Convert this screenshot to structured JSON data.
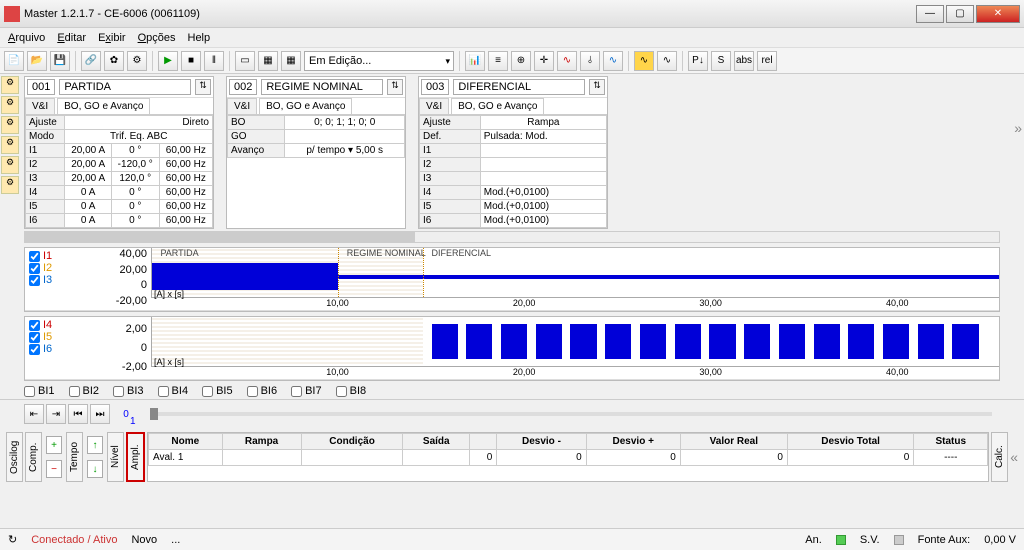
{
  "window": {
    "title": "Master 1.2.1.7 - CE-6006 (0061109)"
  },
  "menu": [
    "Arquivo",
    "Editar",
    "Exibir",
    "Opções",
    "Help"
  ],
  "toolbar_sel": "Em Edição...",
  "panels": [
    {
      "num": "001",
      "name": "PARTIDA",
      "tab_vi": "V&I",
      "tab_bo": "BO, GO e Avanço",
      "ajuste": "Ajuste",
      "dirlab": "Direto",
      "rows": [
        [
          "Modo",
          "Trif. Eq. ABC",
          "",
          ""
        ],
        [
          "I1",
          "20,00 A",
          "0 °",
          "60,00 Hz"
        ],
        [
          "I2",
          "20,00 A",
          "-120,0 °",
          "60,00 Hz"
        ],
        [
          "I3",
          "20,00 A",
          "120,0 °",
          "60,00 Hz"
        ],
        [
          "I4",
          "0 A",
          "0 °",
          "60,00 Hz"
        ],
        [
          "I5",
          "0 A",
          "0 °",
          "60,00 Hz"
        ],
        [
          "I6",
          "0 A",
          "0 °",
          "60,00 Hz"
        ]
      ]
    },
    {
      "num": "002",
      "name": "REGIME NOMINAL",
      "tab_vi": "V&I",
      "tab_bo": "BO, GO e Avanço",
      "rows": [
        [
          "BO",
          "0; 0; 1; 1; 0; 0"
        ],
        [
          "GO",
          ""
        ],
        [
          "Avanço",
          "p/ tempo   ▾   5,00 s"
        ]
      ]
    },
    {
      "num": "003",
      "name": "DIFERENCIAL",
      "tab_vi": "V&I",
      "tab_bo": "BO, GO e Avanço",
      "ajuste": "Ajuste",
      "ramp": "Rampa",
      "def": "Def.",
      "puls": "Pulsada: Mod.",
      "rows": [
        [
          "I1",
          ""
        ],
        [
          "I2",
          ""
        ],
        [
          "I3",
          ""
        ],
        [
          "I4",
          "Mod.(+0,0100)"
        ],
        [
          "I5",
          "Mod.(+0,0100)"
        ],
        [
          "I6",
          "Mod.(+0,0100)"
        ]
      ]
    }
  ],
  "chart1": {
    "legend": [
      "I1",
      "I2",
      "I3"
    ],
    "y": [
      "40,00",
      "20,00",
      "0",
      "-20,00"
    ],
    "unit": "[A] x [s]",
    "sections": [
      "PARTIDA",
      "REGIME NOMINAL",
      "DIFERENCIAL"
    ],
    "x": [
      "10,00",
      "20,00",
      "30,00",
      "40,00"
    ]
  },
  "chart2": {
    "legend": [
      "I4",
      "I5",
      "I6"
    ],
    "y": [
      "2,00",
      "0",
      "-2,00"
    ],
    "unit": "[A] x [s]",
    "x": [
      "10,00",
      "20,00",
      "30,00",
      "40,00"
    ]
  },
  "bi": [
    "BI1",
    "BI2",
    "BI3",
    "BI4",
    "BI5",
    "BI6",
    "BI7",
    "BI8"
  ],
  "slider": {
    "zero": "0",
    "one": "1"
  },
  "vtabs_left": [
    "Oscilog",
    "Comp."
  ],
  "vtabs_mid": [
    "Tempo",
    "Nível",
    "Ampl."
  ],
  "vtab_right": "Calc.",
  "eval": {
    "cols": [
      "Nome",
      "Rampa",
      "Condição",
      "Saída",
      "",
      "Desvio -",
      "Desvio +",
      "Valor Real",
      "Desvio Total",
      "Status"
    ],
    "row": [
      "Aval. 1",
      "",
      "",
      "",
      "0",
      "0",
      "0",
      "0",
      "0",
      "----"
    ]
  },
  "status": {
    "conn": "Conectado / Ativo",
    "novo": "Novo",
    "dots": "...",
    "an": "An.",
    "sv": "S.V.",
    "aux_l": "Fonte Aux:",
    "aux_v": "0,00 V"
  }
}
